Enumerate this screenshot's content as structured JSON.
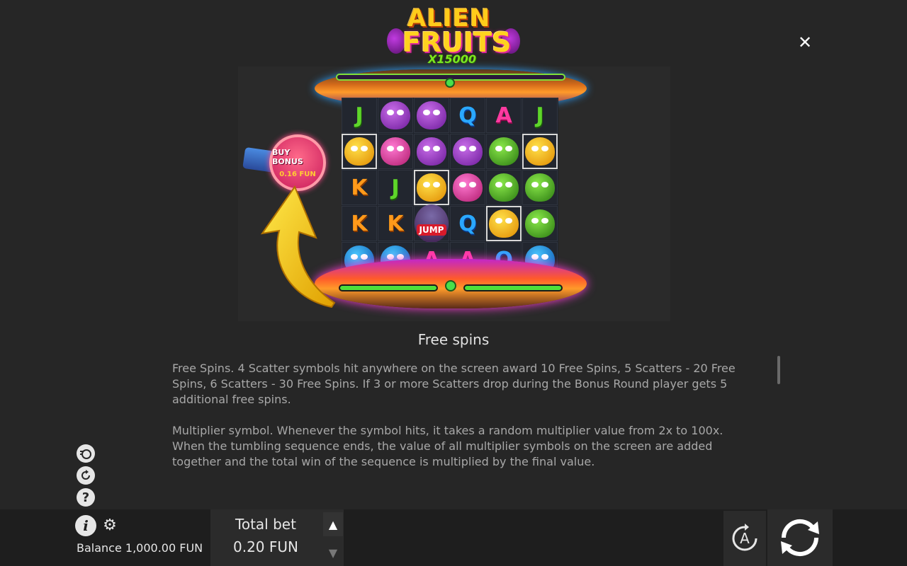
{
  "game": {
    "logo_line1": "ALIEN",
    "logo_line2": "FRUITS",
    "logo_multiplier": "X15000"
  },
  "buy_bonus": {
    "label": "BUY BONUS",
    "price": "0.16 FUN"
  },
  "reels": [
    [
      "J",
      "purple",
      "purple",
      "Q",
      "A",
      "J"
    ],
    [
      "yellow",
      "pink",
      "purple",
      "purple",
      "green",
      "yellow"
    ],
    [
      "K",
      "J",
      "yellow",
      "pink",
      "green",
      "green"
    ],
    [
      "K",
      "K",
      "jump",
      "Q",
      "yellow",
      "green"
    ],
    [
      "blue",
      "blue",
      "A",
      "A",
      "Q",
      "blue"
    ]
  ],
  "jump_label": "JUMP",
  "section": {
    "title": "Free spins",
    "paragraphs": [
      "Free Spins. 4 Scatter symbols hit anywhere on the screen award 10 Free Spins, 5 Scatters - 20 Free Spins, 6 Scatters - 30 Free Spins. If 3 or more Scatters drop during the Bonus Round player gets 5 additional free spins.",
      "Multiplier symbol. Whenever the symbol hits, it takes a random multiplier value from 2x to 100x. When the tumbling sequence ends, the value of all multiplier symbols on the screen are added together and the total win of the sequence is multiplied by the final value."
    ]
  },
  "controls": {
    "close_icon": "✕",
    "balance_label": "Balance 1,000.00 FUN",
    "total_bet_label": "Total bet",
    "total_bet_value": "0.20 FUN",
    "auto_label": "A",
    "help_label": "?",
    "info_label": "i"
  },
  "colors": {
    "background": "#262626",
    "bottom_bar": "#1e1e1e",
    "text": "#a8a8a8"
  }
}
